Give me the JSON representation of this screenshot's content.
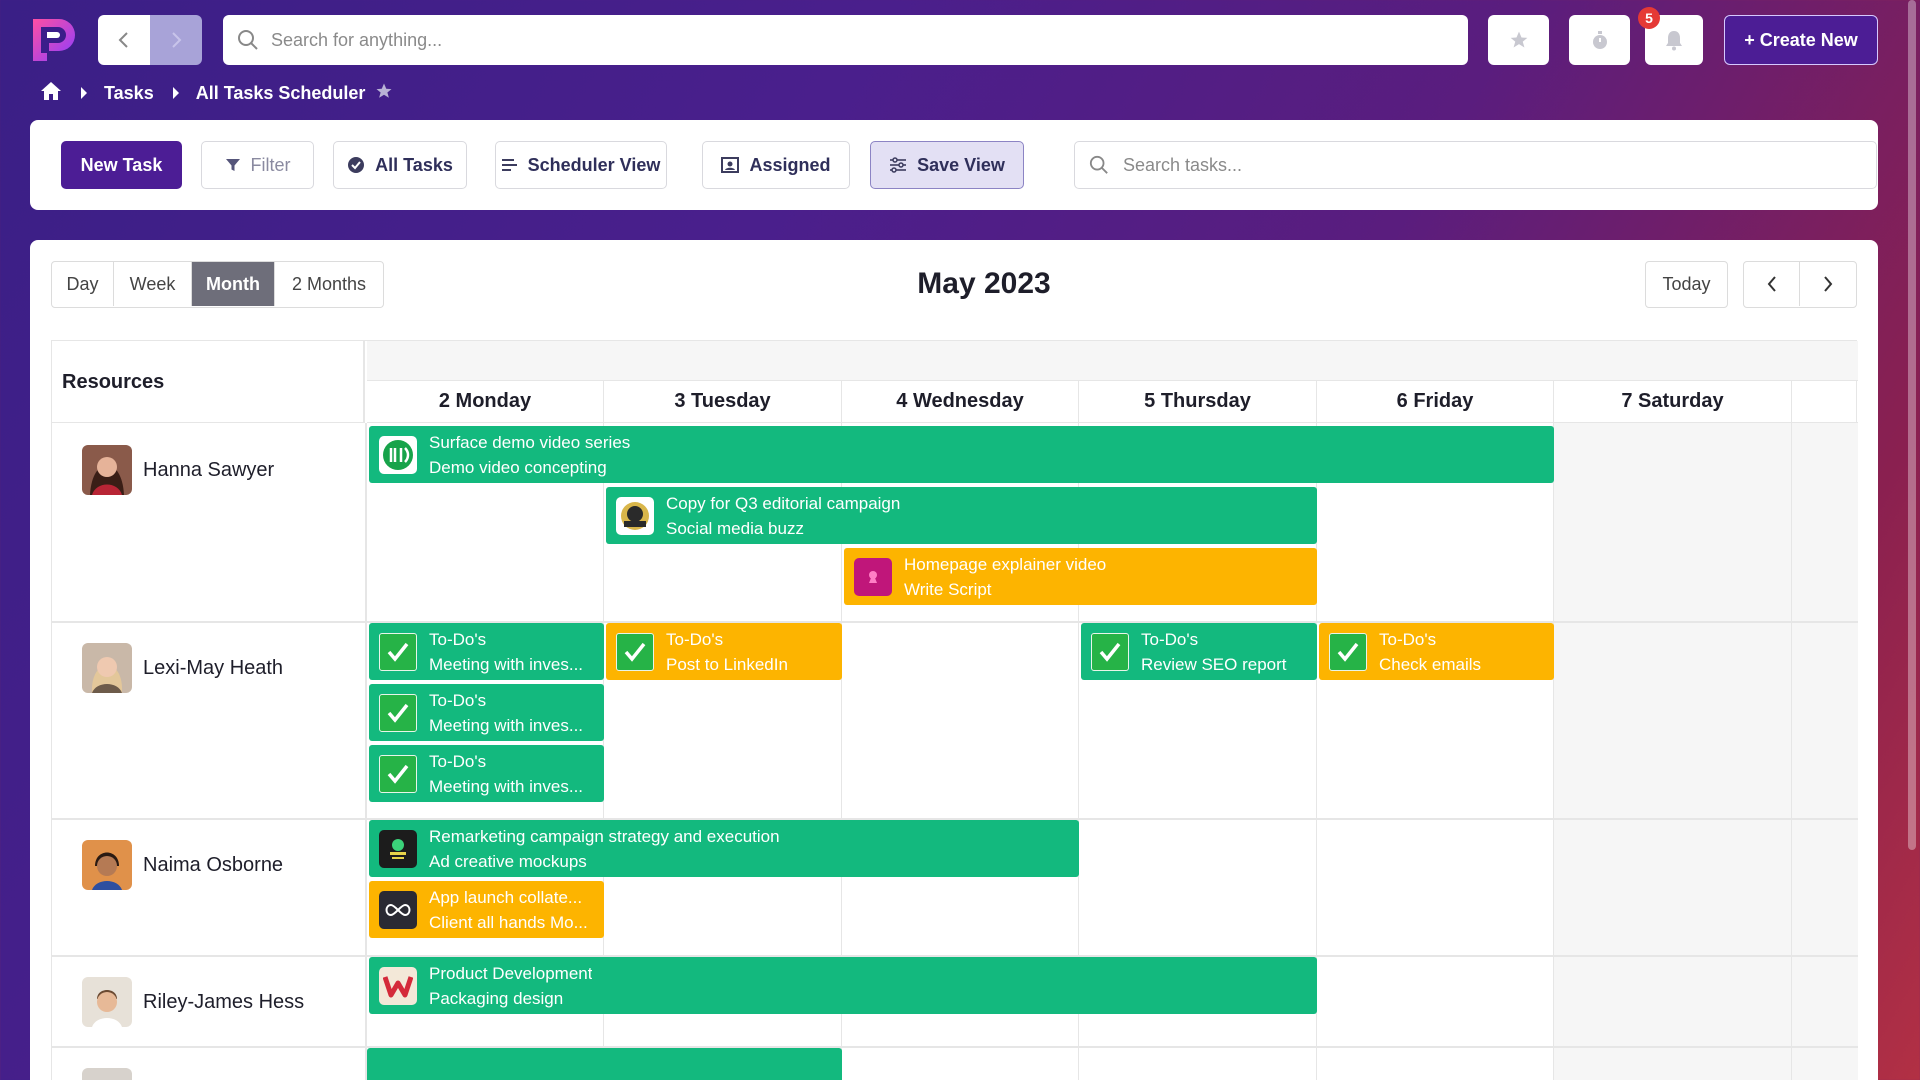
{
  "topbar": {
    "search_placeholder": "Search for anything...",
    "notification_count": "5",
    "create_label": "+ Create New"
  },
  "breadcrumb": {
    "items": [
      "Tasks",
      "All Tasks Scheduler"
    ]
  },
  "toolbar": {
    "new_task": "New Task",
    "filter": "Filter",
    "all_tasks": "All Tasks",
    "scheduler_view": "Scheduler View",
    "assigned": "Assigned",
    "save_view": "Save View",
    "search_placeholder": "Search tasks..."
  },
  "scheduler": {
    "views": [
      "Day",
      "Week",
      "Month",
      "2 Months"
    ],
    "active_view": "Month",
    "title": "May 2023",
    "today_label": "Today",
    "resources_header": "Resources",
    "days": [
      "2 Monday",
      "3 Tuesday",
      "4 Wednesday",
      "5 Thursday",
      "6 Friday",
      "7 Saturday"
    ],
    "resources": [
      {
        "name": "Hanna Sawyer"
      },
      {
        "name": "Lexi-May Heath"
      },
      {
        "name": "Naima Osborne"
      },
      {
        "name": "Riley-James Hess"
      }
    ],
    "events": [
      {
        "title": "Surface demo video series",
        "subtitle": "Demo video concepting",
        "color": "green"
      },
      {
        "title": "Copy for Q3 editorial campaign",
        "subtitle": "Social media buzz",
        "color": "green"
      },
      {
        "title": "Homepage explainer video",
        "subtitle": "Write Script",
        "color": "orange"
      },
      {
        "title": "To-Do's",
        "subtitle": "Meeting with inves...",
        "color": "green"
      },
      {
        "title": "To-Do's",
        "subtitle": "Meeting with inves...",
        "color": "green"
      },
      {
        "title": "To-Do's",
        "subtitle": "Meeting with inves...",
        "color": "green"
      },
      {
        "title": "To-Do's",
        "subtitle": "Post to LinkedIn",
        "color": "orange"
      },
      {
        "title": "To-Do's",
        "subtitle": "Review SEO report",
        "color": "green"
      },
      {
        "title": "To-Do's",
        "subtitle": "Check emails",
        "color": "orange"
      },
      {
        "title": "Remarketing campaign strategy and execution",
        "subtitle": "Ad creative mockups",
        "color": "green"
      },
      {
        "title": "App launch collate...",
        "subtitle": "Client all hands Mo...",
        "color": "orange"
      },
      {
        "title": "Product Development",
        "subtitle": "Packaging design",
        "color": "green"
      }
    ]
  },
  "colors": {
    "primary": "#4c1d95",
    "event_green": "#13b97e",
    "event_orange": "#fdb400",
    "badge_red": "#e53935"
  }
}
